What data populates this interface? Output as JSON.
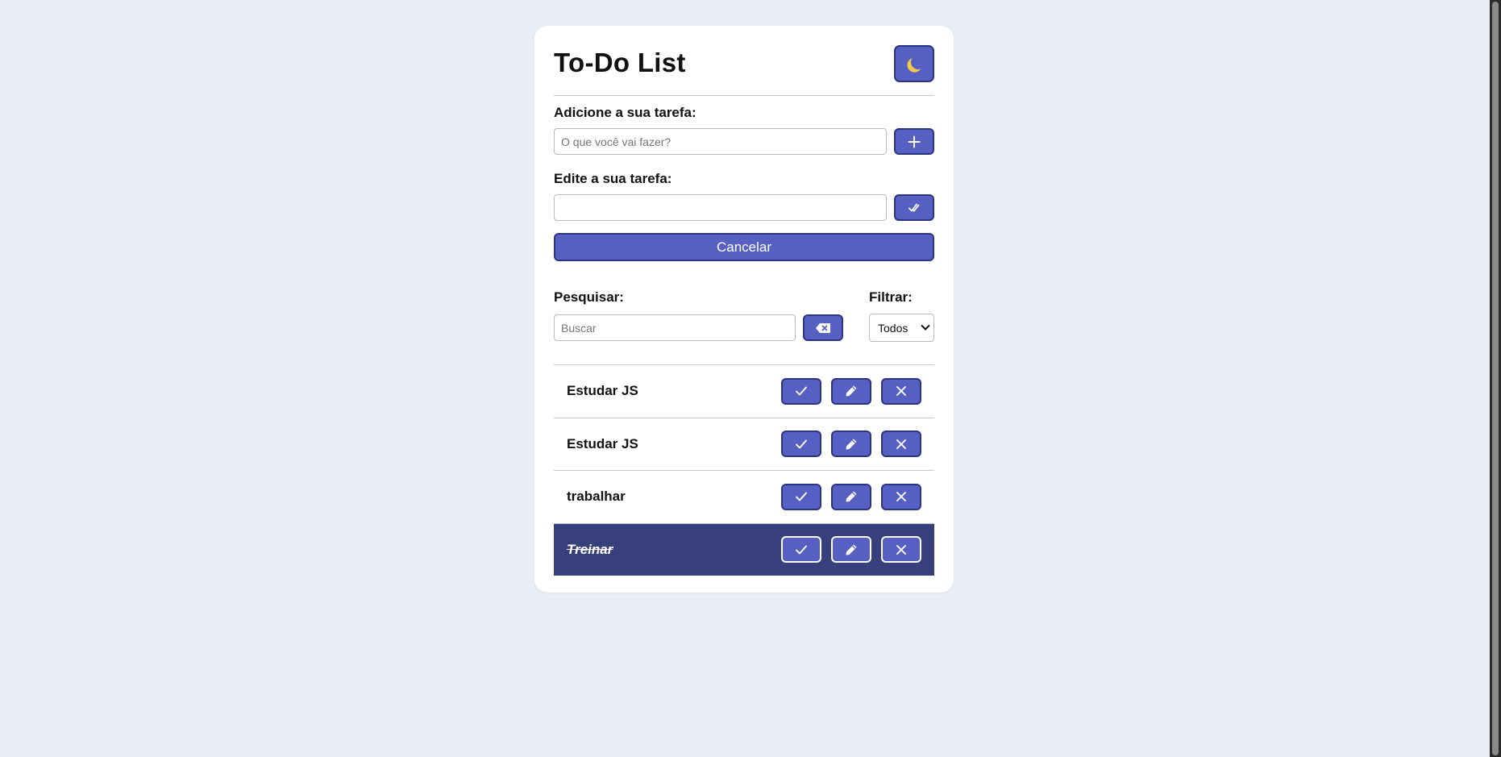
{
  "app": {
    "title": "To-Do List",
    "theme_toggle_icon": "moon-icon"
  },
  "add_form": {
    "label": "Adicione a sua tarefa:",
    "input_value": "",
    "input_placeholder": "O que você vai fazer?",
    "submit_icon": "plus-icon"
  },
  "edit_form": {
    "label": "Edite a sua tarefa:",
    "input_value": "",
    "input_placeholder": "",
    "submit_icon": "double-check-icon",
    "cancel_label": "Cancelar"
  },
  "search": {
    "label": "Pesquisar:",
    "placeholder": "Buscar",
    "clear_icon": "backspace-icon"
  },
  "filter": {
    "label": "Filtrar:",
    "selected": "Todos"
  },
  "todos": [
    {
      "title": "Estudar JS",
      "done": false
    },
    {
      "title": "Estudar JS",
      "done": false
    },
    {
      "title": "trabalhar",
      "done": false
    },
    {
      "title": "Treinar",
      "done": true
    }
  ],
  "colors": {
    "page_bg": "#e9eef6",
    "accent": "#5660c2",
    "accent_border": "#2e3580",
    "done_row_bg": "#38407b"
  }
}
